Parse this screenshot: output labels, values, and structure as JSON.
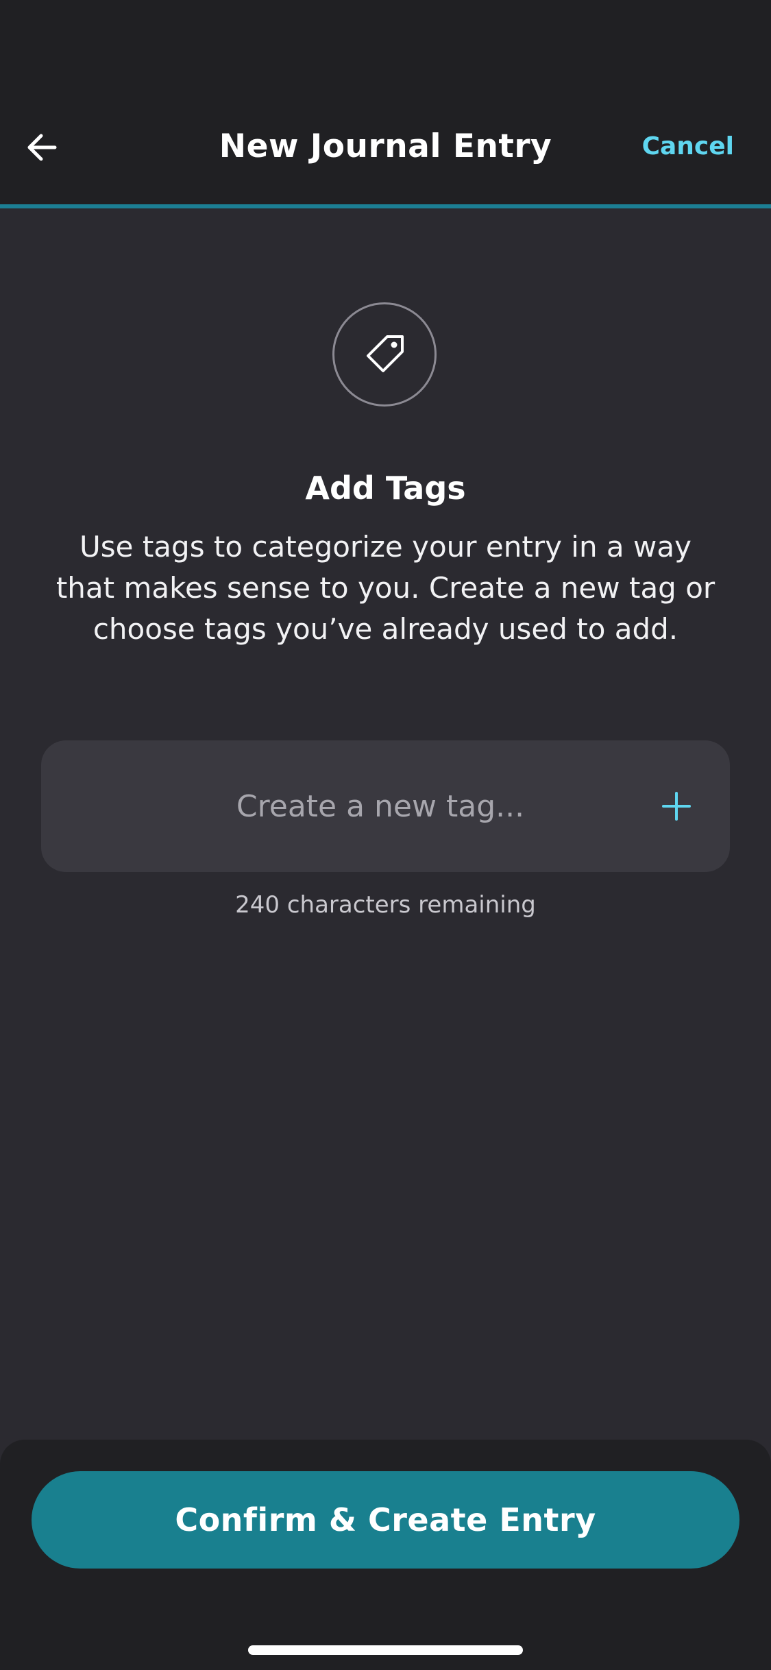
{
  "header": {
    "title": "New Journal Entry",
    "cancel_label": "Cancel",
    "back_icon": "arrow-left-icon",
    "accent_color": "#1c7f94",
    "link_color": "#5fd6f0"
  },
  "tags_section": {
    "icon": "tag-icon",
    "title": "Add Tags",
    "description": "Use tags to categorize your entry in a way that makes sense to you. Create a new tag or choose tags you’ve already used to add."
  },
  "tag_input": {
    "value": "",
    "placeholder": "Create a new tag...",
    "add_icon": "plus-icon",
    "characters_remaining": "240 characters remaining"
  },
  "footer": {
    "confirm_label": "Confirm & Create Entry",
    "button_color": "#19808f"
  }
}
